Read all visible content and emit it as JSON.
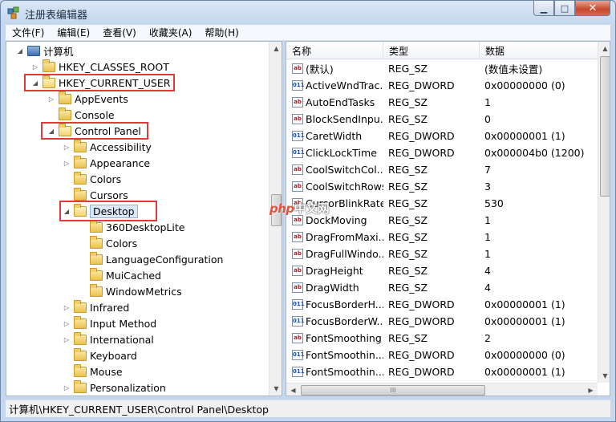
{
  "window": {
    "title": "注册表编辑器",
    "minimize_glyph": "▁",
    "maximize_glyph": "□",
    "close_glyph": "✕"
  },
  "menu": [
    "文件(F)",
    "编辑(E)",
    "查看(V)",
    "收藏夹(A)",
    "帮助(H)"
  ],
  "tree": {
    "root": "计算机",
    "nodes": [
      {
        "label": "HKEY_CLASSES_ROOT",
        "expander": "▷"
      },
      {
        "label": "HKEY_CURRENT_USER",
        "expander": "◢"
      },
      {
        "label": "AppEvents",
        "expander": "▷"
      },
      {
        "label": "Console",
        "expander": ""
      },
      {
        "label": "Control Panel",
        "expander": "◢"
      },
      {
        "label": "Accessibility",
        "expander": "▷"
      },
      {
        "label": "Appearance",
        "expander": "▷"
      },
      {
        "label": "Colors",
        "expander": ""
      },
      {
        "label": "Cursors",
        "expander": ""
      },
      {
        "label": "Desktop",
        "expander": "◢"
      },
      {
        "label": "360DesktopLite",
        "expander": ""
      },
      {
        "label": "Colors",
        "expander": ""
      },
      {
        "label": "LanguageConfiguration",
        "expander": ""
      },
      {
        "label": "MuiCached",
        "expander": ""
      },
      {
        "label": "WindowMetrics",
        "expander": ""
      },
      {
        "label": "Infrared",
        "expander": "▷"
      },
      {
        "label": "Input Method",
        "expander": "▷"
      },
      {
        "label": "International",
        "expander": "▷"
      },
      {
        "label": "Keyboard",
        "expander": ""
      },
      {
        "label": "Mouse",
        "expander": ""
      },
      {
        "label": "Personalization",
        "expander": "▷"
      }
    ]
  },
  "list": {
    "columns": [
      "名称",
      "类型",
      "数据"
    ],
    "rows": [
      {
        "name": "(默认)",
        "type": "REG_SZ",
        "data": "(数值未设置)",
        "icon": "ab"
      },
      {
        "name": "ActiveWndTrac...",
        "type": "REG_DWORD",
        "data": "0x00000000 (0)",
        "icon": "011"
      },
      {
        "name": "AutoEndTasks",
        "type": "REG_SZ",
        "data": "1",
        "icon": "ab"
      },
      {
        "name": "BlockSendInpu...",
        "type": "REG_SZ",
        "data": "0",
        "icon": "ab"
      },
      {
        "name": "CaretWidth",
        "type": "REG_DWORD",
        "data": "0x00000001 (1)",
        "icon": "011"
      },
      {
        "name": "ClickLockTime",
        "type": "REG_DWORD",
        "data": "0x000004b0 (1200)",
        "icon": "011"
      },
      {
        "name": "CoolSwitchCol...",
        "type": "REG_SZ",
        "data": "7",
        "icon": "ab"
      },
      {
        "name": "CoolSwitchRows",
        "type": "REG_SZ",
        "data": "3",
        "icon": "ab"
      },
      {
        "name": "CursorBlinkRate",
        "type": "REG_SZ",
        "data": "530",
        "icon": "ab"
      },
      {
        "name": "DockMoving",
        "type": "REG_SZ",
        "data": "1",
        "icon": "ab"
      },
      {
        "name": "DragFromMaxi...",
        "type": "REG_SZ",
        "data": "1",
        "icon": "ab"
      },
      {
        "name": "DragFullWindo...",
        "type": "REG_SZ",
        "data": "1",
        "icon": "ab"
      },
      {
        "name": "DragHeight",
        "type": "REG_SZ",
        "data": "4",
        "icon": "ab"
      },
      {
        "name": "DragWidth",
        "type": "REG_SZ",
        "data": "4",
        "icon": "ab"
      },
      {
        "name": "FocusBorderH...",
        "type": "REG_DWORD",
        "data": "0x00000001 (1)",
        "icon": "011"
      },
      {
        "name": "FocusBorderW...",
        "type": "REG_DWORD",
        "data": "0x00000001 (1)",
        "icon": "011"
      },
      {
        "name": "FontSmoothing",
        "type": "REG_SZ",
        "data": "2",
        "icon": "ab"
      },
      {
        "name": "FontSmoothin...",
        "type": "REG_DWORD",
        "data": "0x00000000 (0)",
        "icon": "011"
      },
      {
        "name": "FontSmoothin...",
        "type": "REG_DWORD",
        "data": "0x00000001 (1)",
        "icon": "011"
      }
    ]
  },
  "scroll": {
    "up": "▲",
    "down": "▼",
    "left": "◀",
    "right": "▶",
    "grip": "III"
  },
  "status": "计算机\\HKEY_CURRENT_USER\\Control Panel\\Desktop",
  "watermark": {
    "php": "php",
    "text": "中文网"
  }
}
